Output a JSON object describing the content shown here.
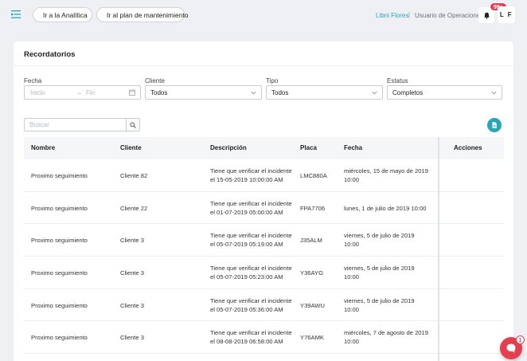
{
  "topbar": {
    "analytics_label": "Ir a la Analítica",
    "plan_label": "Ir al plan de mantenimiento",
    "user_name": "Libni Flores",
    "separator": "|",
    "user_role": "Usuario de Operaciones",
    "notifications_badge": "99+",
    "avatar_initials": "L F"
  },
  "card": {
    "title": "Recordatorios"
  },
  "filters": {
    "fecha_label": "Fecha",
    "fecha_start_placeholder": "Inicio",
    "fecha_arrow": "→",
    "fecha_end_placeholder": "Fin",
    "cliente_label": "Cliente",
    "cliente_value": "Todos",
    "tipo_label": "Tipo",
    "tipo_value": "Todos",
    "estatus_label": "Estatus",
    "estatus_value": "Completos"
  },
  "search": {
    "placeholder": "Buscar"
  },
  "table": {
    "headers": {
      "nombre": "Nombre",
      "cliente": "Cliente",
      "descripcion": "Descripción",
      "placa": "Placa",
      "fecha": "Fecha",
      "acciones": "Acciones"
    },
    "rows": [
      {
        "nombre": "Proximo seguimiento",
        "cliente": "Cliente 82",
        "descripcion": "Tiene que verificar el incidente el 15-05-2019 10:00:00 AM",
        "placa": "LMC880A",
        "fecha": "miércoles, 15 de mayo de 2019 10:00"
      },
      {
        "nombre": "Proximo seguimiento",
        "cliente": "Cliente 22",
        "descripcion": "Tiene que verificar el incidente el 01-07-2019 05:00:00 AM",
        "placa": "FPA7706",
        "fecha": "lunes, 1 de julio de 2019 10:00"
      },
      {
        "nombre": "Proximo seguimiento",
        "cliente": "Cliente 3",
        "descripcion": "Tiene que verificar el incidente el 05-07-2019 05:19:00 AM",
        "placa": "J35ALM",
        "fecha": "viernes, 5 de julio de 2019 10:00"
      },
      {
        "nombre": "Proximo seguimiento",
        "cliente": "Cliente 3",
        "descripcion": "Tiene que verificar el incidente el 05-07-2019 05:23:00 AM",
        "placa": "Y36AYG",
        "fecha": "viernes, 5 de julio de 2019 10:00"
      },
      {
        "nombre": "Proximo seguimiento",
        "cliente": "Cliente 3",
        "descripcion": "Tiene que verificar el incidente el 05-07-2019 05:36:00 AM",
        "placa": "Y39AWU",
        "fecha": "viernes, 5 de julio de 2019 10:00"
      },
      {
        "nombre": "Proximo seguimiento",
        "cliente": "Cliente 3",
        "descripcion": "Tiene que verificar el incidente el 08-08-2019 06:58:00 AM",
        "placa": "Y76AMK",
        "fecha": "miércoles, 7 de agosto de 2019 10:00"
      }
    ]
  },
  "chat": {
    "badge": "1"
  },
  "colors": {
    "accent": "#2aa7b7",
    "danger": "#e53e4f",
    "background": "#eef0f4"
  },
  "icons": [
    "menu-icon",
    "chart-icon",
    "clipboard-icon",
    "bell-icon",
    "calendar-icon",
    "chevron-down-icon",
    "search-icon",
    "file-icon",
    "chat-icon"
  ]
}
